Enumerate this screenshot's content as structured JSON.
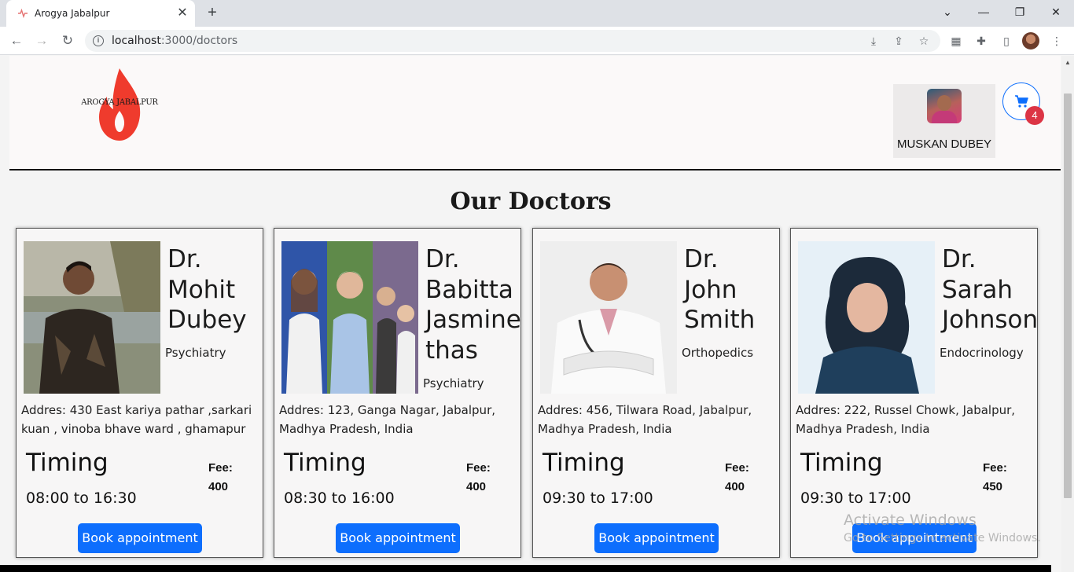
{
  "browser": {
    "tab_title": "Arogya Jabalpur",
    "tab_close": "✕",
    "new_tab": "+",
    "url_host": "localhost",
    "url_rest": ":3000/doctors",
    "win_minimize": "—",
    "win_restore": "❐",
    "win_close": "✕"
  },
  "header": {
    "logo_text": "AROGYA JABALPUR",
    "user_name": "MUSKAN DUBEY",
    "cart_count": "4",
    "accent_color": "#0d6efd",
    "badge_color": "#dc3545"
  },
  "page": {
    "heading": "Our Doctors"
  },
  "labels": {
    "timing": "Timing",
    "fee": "Fee:",
    "book": "Book appointment"
  },
  "doctors": [
    {
      "name": "Dr. Mohit Dubey",
      "specialty": "Psychiatry",
      "address": "Addres: 430 East kariya pathar ,sarkari kuan , vinoba bhave ward , ghamapur",
      "timing": "08:00 to 16:30",
      "fee": "400"
    },
    {
      "name": "Dr. Babitta Jasmine thas",
      "specialty": "Psychiatry",
      "address": "Addres: 123, Ganga Nagar, Jabalpur, Madhya Pradesh, India",
      "timing": "08:30 to 16:00",
      "fee": "400"
    },
    {
      "name": "Dr. John Smith",
      "specialty": "Orthopedics",
      "address": "Addres: 456, Tilwara Road, Jabalpur, Madhya Pradesh, India",
      "timing": "09:30 to 17:00",
      "fee": "400"
    },
    {
      "name": "Dr. Sarah Johnson",
      "specialty": "Endocrinology",
      "address": "Addres: 222, Russel Chowk, Jabalpur, Madhya Pradesh, India",
      "timing": "09:30 to 17:00",
      "fee": "450"
    }
  ],
  "watermark": {
    "line1": "Activate Windows",
    "line2": "Go to Settings to activate Windows."
  }
}
